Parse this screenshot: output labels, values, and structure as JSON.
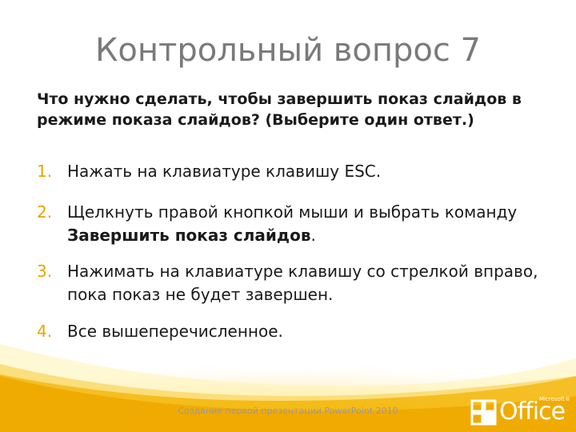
{
  "slide": {
    "title": "Контрольный вопрос 7",
    "question": "Что нужно сделать, чтобы завершить показ слайдов в режиме показа слайдов? (Выберите один ответ.)",
    "answers": [
      {
        "num": "1.",
        "text": "Нажать на клавиатуре клавишу ESC."
      },
      {
        "num": "2.",
        "text_before": "Щелкнуть правой кнопкой мыши и выбрать команду ",
        "bold": "Завершить показ слайдов",
        "text_after": "."
      },
      {
        "num": "3.",
        "text": "Нажимать на клавиатуре клавишу со стрелкой вправо, пока показ не будет завершен."
      },
      {
        "num": "4.",
        "text": "Все вышеперечисленное."
      }
    ],
    "footer": "Создание первой презентации PowerPoint 2010",
    "logo": {
      "brand": "Microsoft®",
      "name": "Office"
    }
  },
  "colors": {
    "title": "#7a7a7a",
    "number_accent": "#e8a400",
    "swoosh": "#f5c400",
    "footer": "#9a9a9a"
  }
}
